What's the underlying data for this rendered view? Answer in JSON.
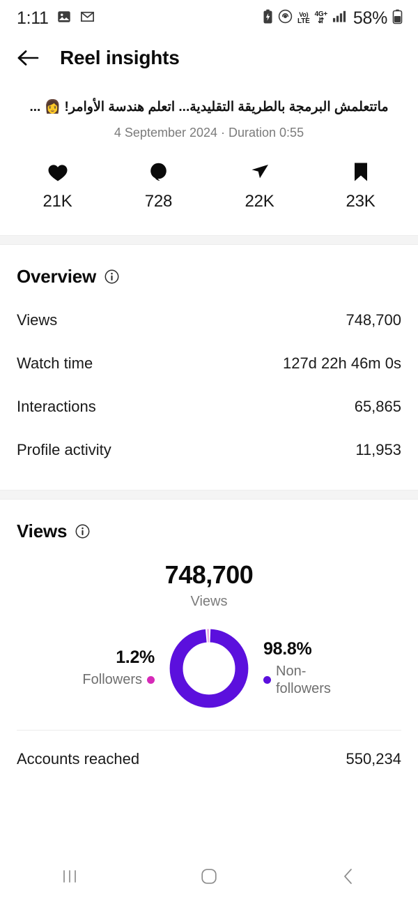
{
  "status_bar": {
    "time": "1:11",
    "left_icons": [
      "photos-icon",
      "gmail-icon"
    ],
    "volte_top": "Vo)",
    "volte_bottom": "LTE",
    "network": "4G+",
    "battery_percent": "58%",
    "right_icons": [
      "battery-charging-icon",
      "hotspot-icon",
      "volte-icon",
      "network-4gplus-icon",
      "signal-bars-icon",
      "battery-icon"
    ]
  },
  "header": {
    "back_icon": "arrow-left-icon",
    "title": "Reel insights"
  },
  "post": {
    "caption": "ماتتعلمش البرمجة بالطريقة التقليدية... اتعلم هندسة الأوامر! 👩 ...",
    "meta": "4 September 2024 · Duration 0:55",
    "stats": [
      {
        "icon": "heart-icon",
        "value": "21K",
        "name": "likes"
      },
      {
        "icon": "comment-icon",
        "value": "728",
        "name": "comments"
      },
      {
        "icon": "share-icon",
        "value": "22K",
        "name": "shares"
      },
      {
        "icon": "bookmark-icon",
        "value": "23K",
        "name": "saves"
      }
    ]
  },
  "overview": {
    "title": "Overview",
    "info_icon": "info-icon",
    "rows": [
      {
        "label": "Views",
        "value": "748,700"
      },
      {
        "label": "Watch time",
        "value": "127d 22h 46m 0s"
      },
      {
        "label": "Interactions",
        "value": "65,865"
      },
      {
        "label": "Profile activity",
        "value": "11,953"
      }
    ]
  },
  "views_section": {
    "title": "Views",
    "info_icon": "info-icon",
    "total": "748,700",
    "total_label": "Views",
    "followers_pct": "1.2%",
    "followers_label": "Followers",
    "nonfollowers_pct": "98.8%",
    "nonfollowers_label": "Non-followers",
    "accounts_reached_label": "Accounts reached",
    "accounts_reached_value": "550,234"
  },
  "chart_data": {
    "type": "pie",
    "title": "Views",
    "subtitle": "748,700 Views",
    "categories": [
      "Non-followers",
      "Followers"
    ],
    "values": [
      98.8,
      1.2
    ],
    "unit": "percent",
    "colors": [
      "#5B10DD",
      "#D62AB8"
    ],
    "legend": "sides",
    "donut": true,
    "total": 748700
  },
  "colors": {
    "purple": "#5B10DD",
    "magenta": "#D62AB8",
    "text": "#0b0b0b",
    "muted": "#7b7b7b",
    "band": "#f4f4f4"
  },
  "nav_bar": {
    "recents_icon": "recents-icon",
    "home_icon": "home-icon",
    "back_icon": "chevron-left-icon"
  }
}
